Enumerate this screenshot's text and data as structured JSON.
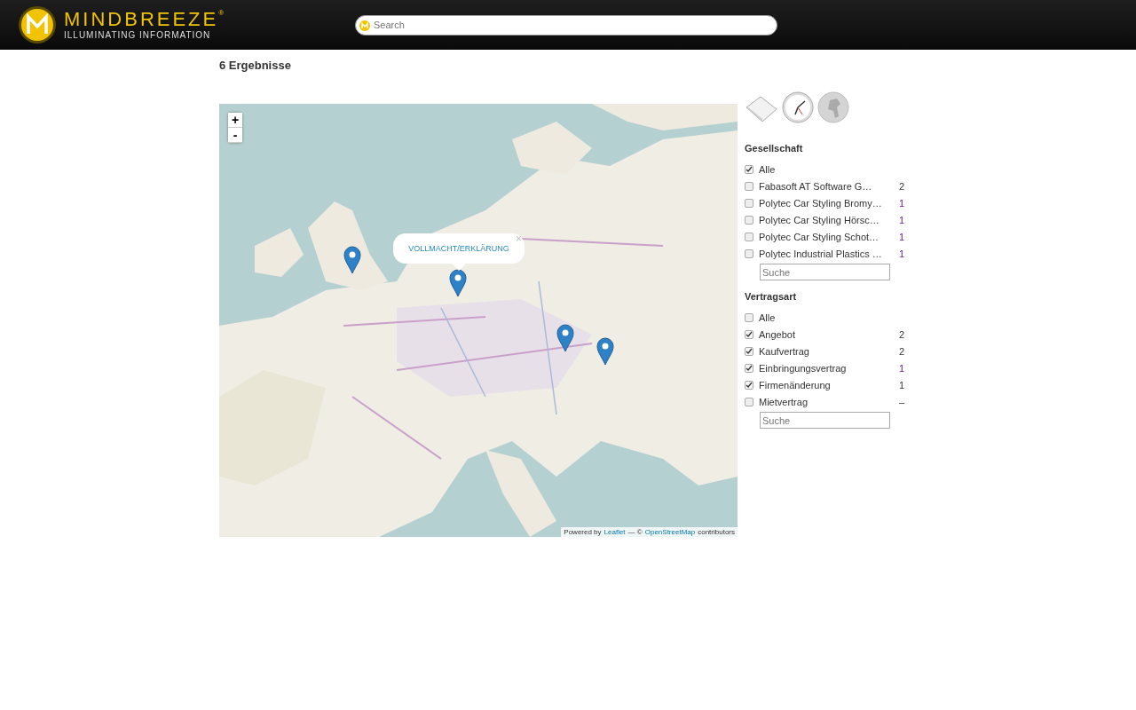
{
  "header": {
    "logo_title": "MINDBREEZE",
    "logo_mark": "®",
    "logo_tagline": "ILLUMINATING INFORMATION",
    "search": {
      "placeholder": "Search"
    }
  },
  "results_title": "6 Ergebnisse",
  "map": {
    "zoom_in": "+",
    "zoom_out": "-",
    "popup": {
      "title": "VOLLMACHT/ERKLÄRUNG",
      "close": "×"
    },
    "attribution": {
      "prefix": "Powered by",
      "leaflet": "Leaflet",
      "separator": "— ©",
      "osm": "OpenStreetMap",
      "suffix": "contributors"
    }
  },
  "facets": [
    {
      "title": "Gesellschaft",
      "items": [
        {
          "label": "Alle",
          "checked": true
        },
        {
          "label": "Fabasoft AT Software G…",
          "checked": false,
          "count": "2",
          "visited": false
        },
        {
          "label": "Polytec Car Styling Bromy…",
          "checked": false,
          "count": "1",
          "visited": true
        },
        {
          "label": "Polytec Car Styling Hörsc…",
          "checked": false,
          "count": "1",
          "visited": true
        },
        {
          "label": "Polytec Car Styling Schot…",
          "checked": false,
          "count": "1",
          "visited": true
        },
        {
          "label": "Polytec Industrial Plastics …",
          "checked": false,
          "count": "1",
          "visited": true
        }
      ],
      "search": {
        "placeholder": "Suche"
      }
    },
    {
      "title": "Vertragsart",
      "items": [
        {
          "label": "Alle",
          "checked": false
        },
        {
          "label": "Angebot",
          "checked": true,
          "count": "2",
          "visited": false
        },
        {
          "label": "Kaufvertrag",
          "checked": true,
          "count": "2",
          "visited": false
        },
        {
          "label": "Einbringungsvertrag",
          "checked": true,
          "count": "1",
          "visited": true
        },
        {
          "label": "Firmenänderung",
          "checked": true,
          "count": "1",
          "visited": false
        },
        {
          "label": "Mietvertrag",
          "checked": false,
          "count": "–",
          "visited": false
        }
      ],
      "search": {
        "placeholder": "Suche"
      }
    }
  ]
}
